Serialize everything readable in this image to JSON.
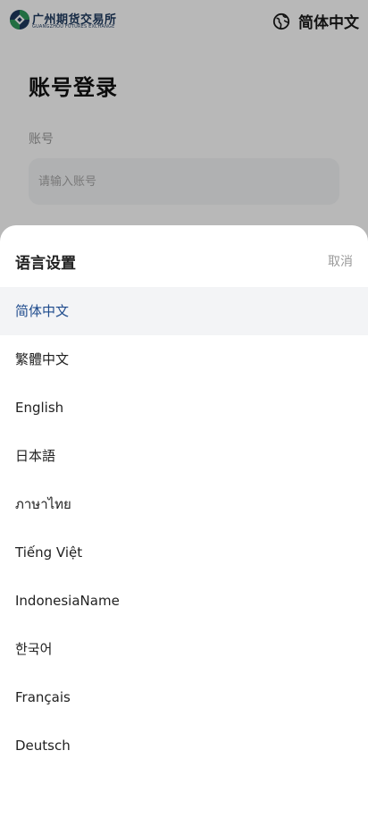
{
  "header": {
    "logo": {
      "name_cn": "广州期货交易所",
      "name_en": "GUANGZHOU FUTURES EXCHANGE",
      "icon": "gfex-logo-mark"
    },
    "language_switch": {
      "icon": "globe-icon",
      "label": "简体中文"
    }
  },
  "login": {
    "title": "账号登录",
    "account_label": "账号",
    "account_input": {
      "value": "",
      "placeholder": "请输入账号"
    }
  },
  "language_sheet": {
    "title": "语言设置",
    "cancel_label": "取消",
    "selected_index": 0,
    "options": [
      {
        "label": "简体中文"
      },
      {
        "label": "繁體中文"
      },
      {
        "label": "English"
      },
      {
        "label": "日本語"
      },
      {
        "label": "ภาษาไทย"
      },
      {
        "label": "Tiếng Việt"
      },
      {
        "label": "IndonesiaName"
      },
      {
        "label": "한국어"
      },
      {
        "label": "Français"
      },
      {
        "label": "Deutsch"
      }
    ]
  },
  "colors": {
    "selected_text": "#1d4a8c",
    "selected_background": "#f3f4f6",
    "overlay": "rgba(0,0,0,0.28)",
    "logo_green": "#2e9a5a",
    "logo_blue": "#1e3a5f"
  }
}
